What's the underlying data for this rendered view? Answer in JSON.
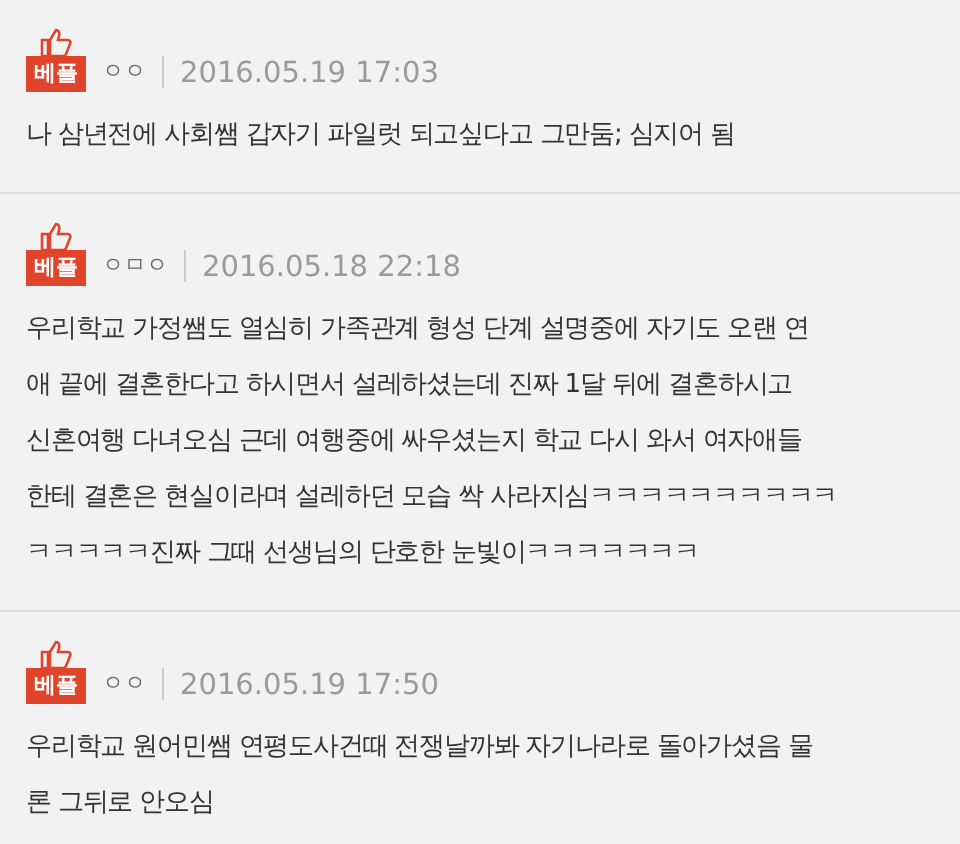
{
  "comments": [
    {
      "badge": "베플",
      "author": "ㅇㅇ",
      "date": "2016.05.19 17:03",
      "lines": [
        "나 삼년전에 사회쌤 갑자기 파일럿 되고싶다고 그만둠; 심지어 됨"
      ]
    },
    {
      "badge": "베플",
      "author": "ㅇㅁㅇ",
      "date": "2016.05.18 22:18",
      "lines": [
        "우리학교 가정쌤도 열심히 가족관계 형성 단계 설명중에 자기도 오랜 연",
        "애 끝에 결혼한다고 하시면서 설레하셨는데 진짜 1달 뒤에 결혼하시고",
        "신혼여행 다녀오심 근데 여행중에 싸우셨는지 학교 다시 와서 여자애들",
        "한테 결혼은 현실이라며 설레하던 모습 싹 사라지심ㅋㅋㅋㅋㅋㅋㅋㅋㅋㅋ",
        "ㅋㅋㅋㅋㅋ진짜 그때 선생님의 단호한 눈빛이ㅋㅋㅋㅋㅋㅋㅋ"
      ]
    },
    {
      "badge": "베플",
      "author": "ㅇㅇ",
      "date": "2016.05.19 17:50",
      "lines": [
        "우리학교 원어민쌤 연평도사건때 전쟁날까봐 자기나라로 돌아가셨음 물",
        "론 그뒤로 안오심"
      ]
    }
  ]
}
